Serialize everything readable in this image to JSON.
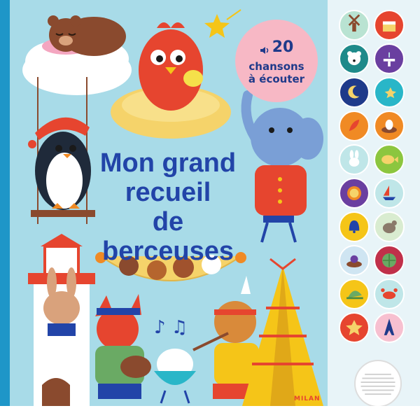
{
  "badge": {
    "count": "20",
    "line1": "chansons",
    "line2": "à écouter"
  },
  "title": {
    "line1": "Mon grand",
    "line2": "recueil",
    "line3": "de berceuses"
  },
  "publisher": "MILAN",
  "colors": {
    "spine": "#1e96c8",
    "cover": "#a8dbe8",
    "title": "#2244a8",
    "badge": "#f7b8c5"
  },
  "sound_buttons": [
    {
      "icon": "windmill-icon",
      "color": "#b9e3d2"
    },
    {
      "icon": "cake-icon",
      "color": "#e6452f"
    },
    {
      "icon": "polar-bear-icon",
      "color": "#1e8a8a"
    },
    {
      "icon": "fountain-icon",
      "color": "#6a3fa0"
    },
    {
      "icon": "moon-icon",
      "color": "#1f3a8a"
    },
    {
      "icon": "shooting-star-icon",
      "color": "#29b6c8"
    },
    {
      "icon": "feather-icon",
      "color": "#f08a24"
    },
    {
      "icon": "egg-nest-icon",
      "color": "#f08a24"
    },
    {
      "icon": "bunny-icon",
      "color": "#bfe6e8"
    },
    {
      "icon": "fish-icon",
      "color": "#8cc63f"
    },
    {
      "icon": "lion-icon",
      "color": "#6a3fa0"
    },
    {
      "icon": "sailboat-icon",
      "color": "#bfe6e8"
    },
    {
      "icon": "bell-icon",
      "color": "#f5c518"
    },
    {
      "icon": "hen-icon",
      "color": "#d9ecd0"
    },
    {
      "icon": "bird-nest-icon",
      "color": "#cfe5f2"
    },
    {
      "icon": "cabbage-icon",
      "color": "#c0304a"
    },
    {
      "icon": "hat-icon",
      "color": "#f5c518"
    },
    {
      "icon": "crab-icon",
      "color": "#bfe6e8"
    },
    {
      "icon": "star-icon",
      "color": "#e6452f"
    },
    {
      "icon": "eiffel-tower-icon",
      "color": "#f7c0d0"
    }
  ]
}
